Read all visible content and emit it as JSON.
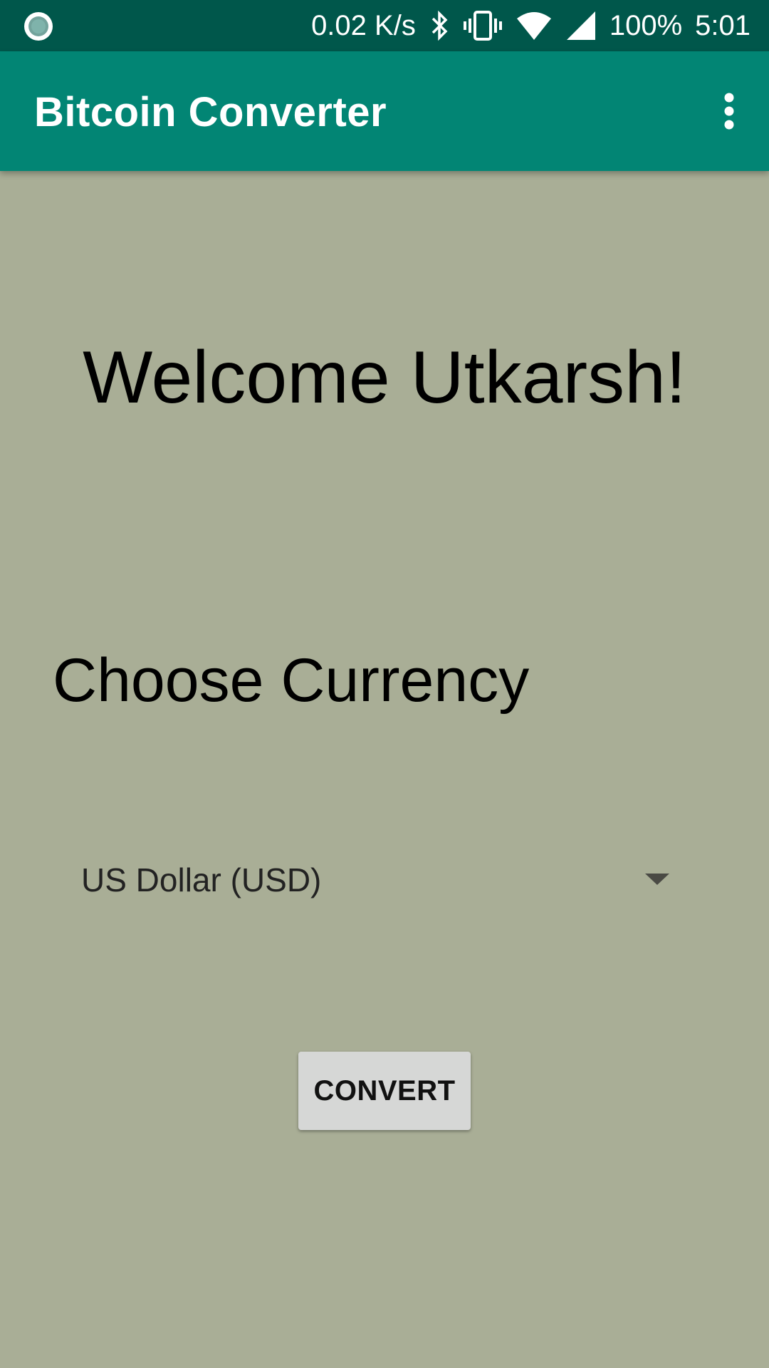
{
  "status_bar": {
    "net_speed": "0.02 K/s",
    "battery": "100%",
    "time": "5:01",
    "icons": [
      "record-icon",
      "bluetooth-icon",
      "vibrate-icon",
      "wifi-icon",
      "cell-signal-icon"
    ]
  },
  "app_bar": {
    "title": "Bitcoin Converter",
    "overflow_icon": "more-vert-icon",
    "color": "#028574"
  },
  "main": {
    "welcome": "Welcome Utkarsh!",
    "choose_label": "Choose Currency",
    "currency_spinner": {
      "selected": "US Dollar (USD)",
      "icon": "dropdown-arrow-icon"
    },
    "convert_button": "CONVERT"
  },
  "colors": {
    "status_bar": "#00574b",
    "background": "#a9ae96",
    "button": "#d6d7d6"
  }
}
